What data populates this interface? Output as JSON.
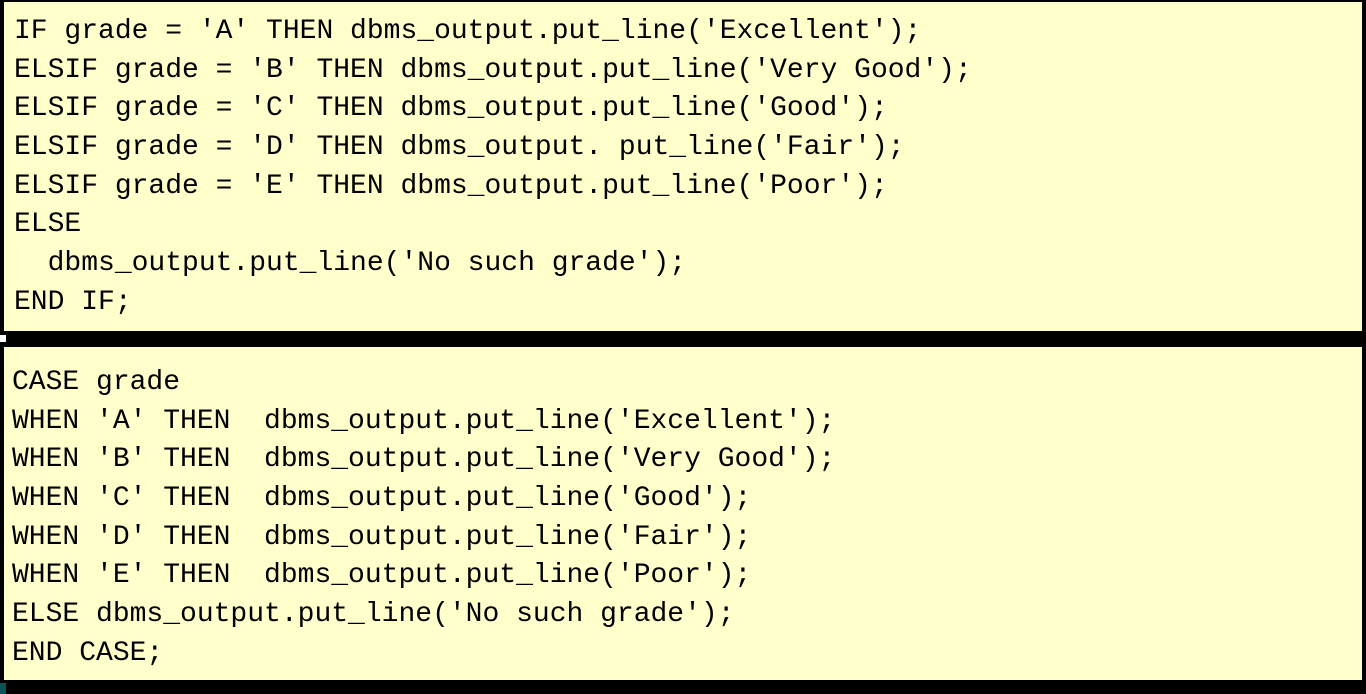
{
  "if_block": {
    "lines": [
      "IF grade = 'A' THEN dbms_output.put_line('Excellent');",
      "ELSIF grade = 'B' THEN dbms_output.put_line('Very Good');",
      "ELSIF grade = 'C' THEN dbms_output.put_line('Good');",
      "ELSIF grade = 'D' THEN dbms_output. put_line('Fair');",
      "ELSIF grade = 'E' THEN dbms_output.put_line('Poor');",
      "ELSE",
      "  dbms_output.put_line('No such grade');",
      "END IF;"
    ]
  },
  "case_block": {
    "lines": [
      "CASE grade",
      "WHEN 'A' THEN  dbms_output.put_line('Excellent');",
      "WHEN 'B' THEN  dbms_output.put_line('Very Good');",
      "WHEN 'C' THEN  dbms_output.put_line('Good');",
      "WHEN 'D' THEN  dbms_output.put_line('Fair');",
      "WHEN 'E' THEN  dbms_output.put_line('Poor');",
      "ELSE dbms_output.put_line('No such grade');",
      "END CASE;"
    ]
  },
  "colors": {
    "panel_background": "#ffffcc",
    "page_background": "#000000",
    "text": "#000000"
  }
}
